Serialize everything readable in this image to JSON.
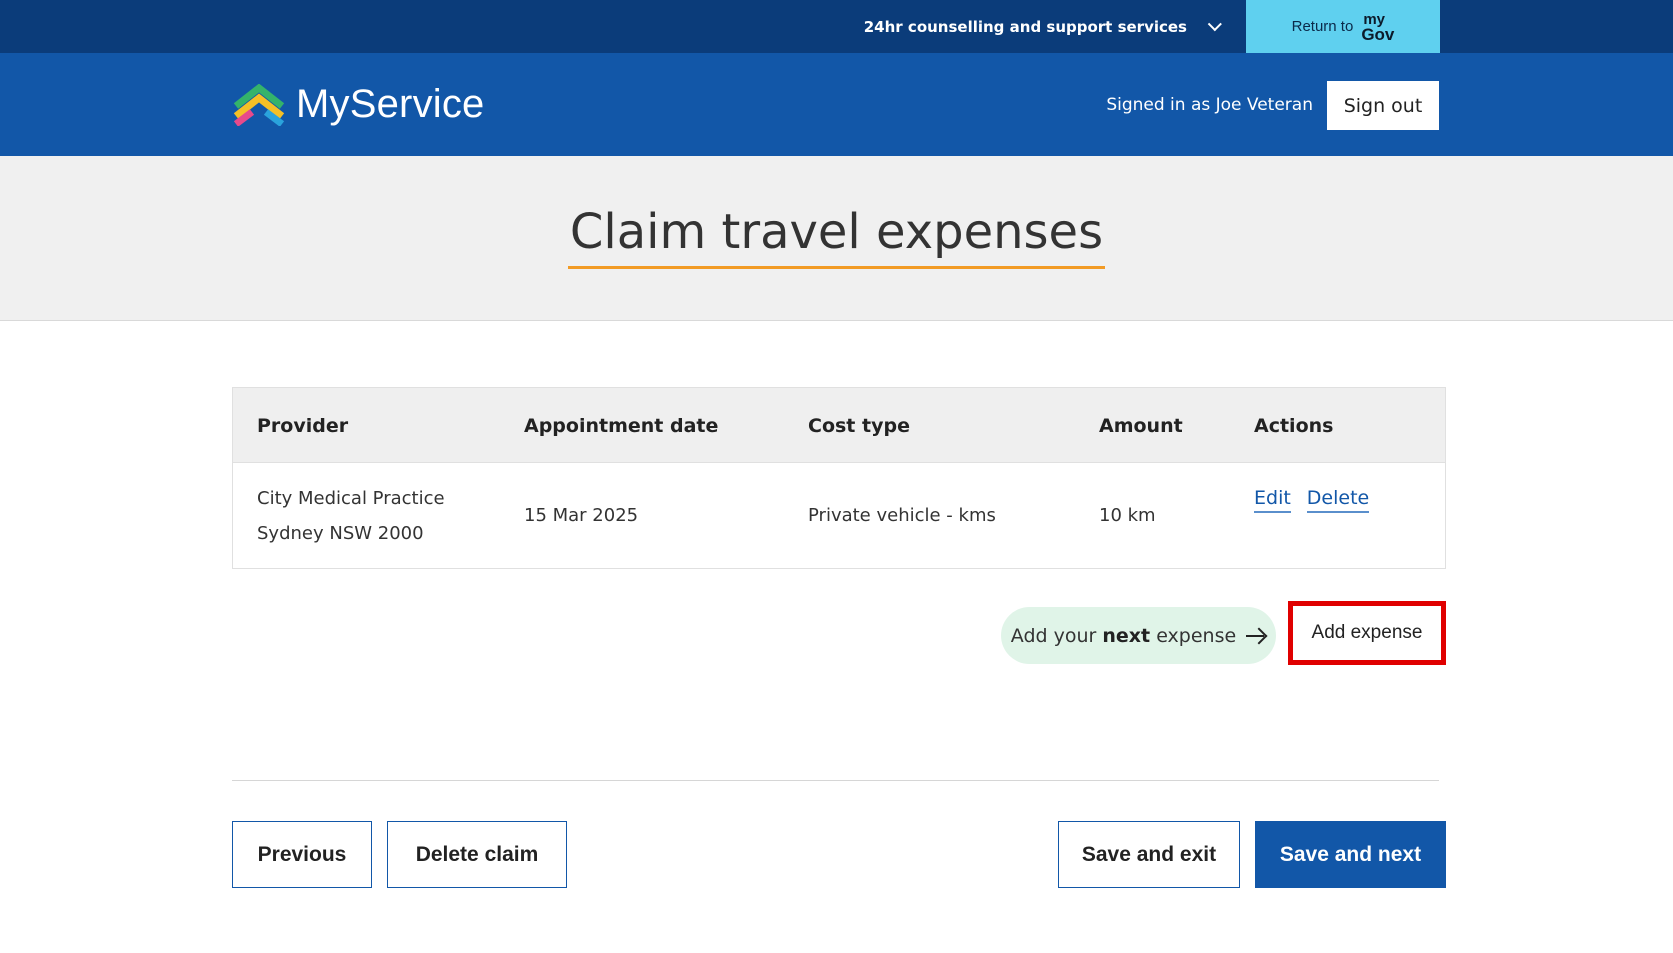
{
  "topbar": {
    "counselling_label": "24hr counselling and support services",
    "return_label": "Return to",
    "mygov_line1": "my",
    "mygov_line2": "Gov"
  },
  "header": {
    "brand_name": "MyService",
    "signed_in_text": "Signed in as Joe Veteran",
    "sign_out_label": "Sign out"
  },
  "page": {
    "title": "Claim travel expenses"
  },
  "table": {
    "headers": [
      "Provider",
      "Appointment date",
      "Cost type",
      "Amount",
      "Actions"
    ],
    "rows": [
      {
        "provider_line1": "City Medical Practice",
        "provider_line2": "Sydney NSW 2000",
        "appointment_date": "15 Mar 2025",
        "cost_type": "Private vehicle - kms",
        "amount": "10 km",
        "edit_label": "Edit",
        "delete_label": "Delete"
      }
    ]
  },
  "hint": {
    "prefix": "Add your",
    "emphasis": "next",
    "suffix": "expense"
  },
  "add_expense_label": "Add expense",
  "footer": {
    "previous_label": "Previous",
    "delete_claim_label": "Delete claim",
    "save_exit_label": "Save and exit",
    "save_next_label": "Save and next"
  },
  "colors": {
    "topbar": "#0b3c7a",
    "header": "#1257a8",
    "mygov_button": "#5fd0ef",
    "title_underline": "#f29b25",
    "hint_pill": "#e0f4e8",
    "highlight_border": "#e00000"
  }
}
